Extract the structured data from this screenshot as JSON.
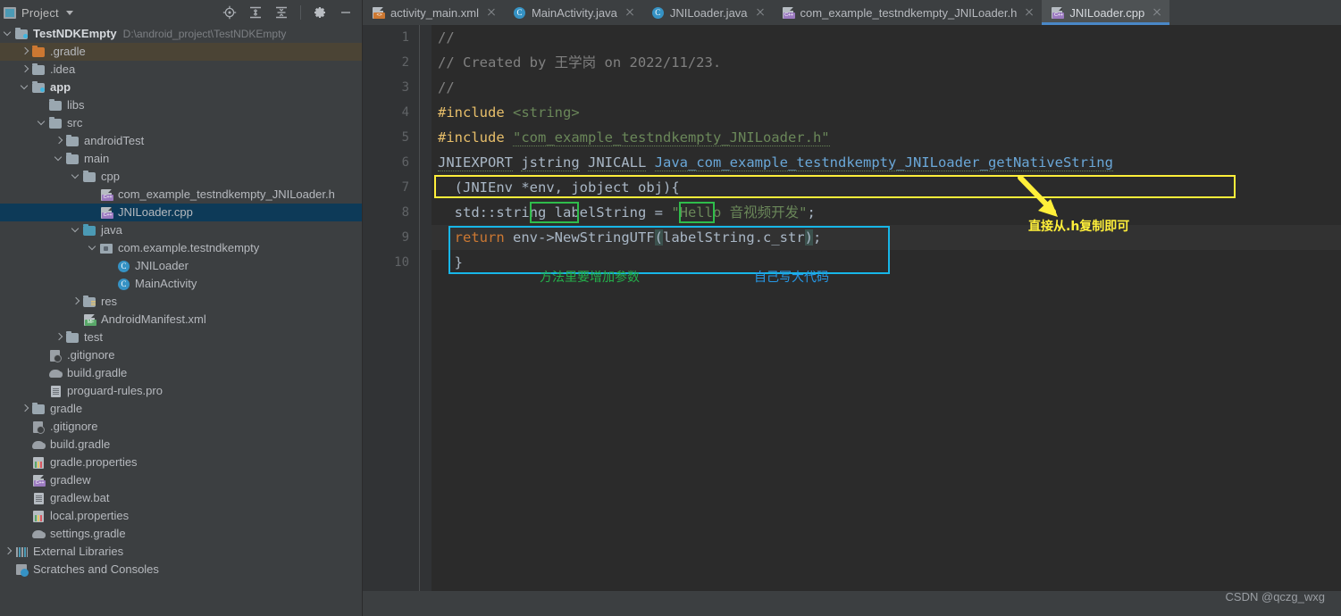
{
  "panel": {
    "title": "Project",
    "icon": "project-icon",
    "dropdown_icon": "chevron-down-icon",
    "tools": [
      {
        "name": "locate-icon",
        "label": "Select Opened File"
      },
      {
        "name": "expand-all-icon",
        "label": "Expand All"
      },
      {
        "name": "collapse-all-icon",
        "label": "Collapse All"
      },
      {
        "name": "settings-gear-icon",
        "label": "Settings"
      },
      {
        "name": "minimize-icon",
        "label": "Hide"
      }
    ]
  },
  "tree": [
    {
      "indent": 0,
      "arrow": "down",
      "icon": "module-folder-icon",
      "label": "TestNDKEmpty",
      "bold": true,
      "sub": "D:\\android_project\\TestNDKEmpty",
      "state": "normal"
    },
    {
      "indent": 1,
      "arrow": "right",
      "icon": "folder-orange-icon",
      "label": ".gradle",
      "state": "hover"
    },
    {
      "indent": 1,
      "arrow": "right",
      "icon": "folder-icon",
      "label": ".idea",
      "state": "normal"
    },
    {
      "indent": 1,
      "arrow": "down",
      "icon": "module-folder-icon",
      "label": "app",
      "bold": true,
      "state": "normal"
    },
    {
      "indent": 2,
      "arrow": "none",
      "icon": "folder-icon",
      "label": "libs",
      "state": "normal"
    },
    {
      "indent": 2,
      "arrow": "down",
      "icon": "folder-icon",
      "label": "src",
      "state": "normal"
    },
    {
      "indent": 3,
      "arrow": "right",
      "icon": "folder-icon",
      "label": "androidTest",
      "state": "normal"
    },
    {
      "indent": 3,
      "arrow": "down",
      "icon": "folder-icon",
      "label": "main",
      "state": "normal"
    },
    {
      "indent": 4,
      "arrow": "down",
      "icon": "folder-icon",
      "label": "cpp",
      "state": "normal"
    },
    {
      "indent": 5,
      "arrow": "none",
      "icon": "cpp-file-icon",
      "label": "com_example_testndkempty_JNILoader.h",
      "state": "normal"
    },
    {
      "indent": 5,
      "arrow": "none",
      "icon": "cpp-file-icon",
      "label": "JNILoader.cpp",
      "state": "selected"
    },
    {
      "indent": 4,
      "arrow": "down",
      "icon": "folder-blue-icon",
      "label": "java",
      "state": "normal"
    },
    {
      "indent": 5,
      "arrow": "down",
      "icon": "package-icon",
      "label": "com.example.testndkempty",
      "state": "normal"
    },
    {
      "indent": 6,
      "arrow": "none",
      "icon": "java-class-icon",
      "label": "JNILoader",
      "state": "normal"
    },
    {
      "indent": 6,
      "arrow": "none",
      "icon": "java-class-icon",
      "label": "MainActivity",
      "state": "normal"
    },
    {
      "indent": 4,
      "arrow": "right",
      "icon": "res-folder-icon",
      "label": "res",
      "state": "normal"
    },
    {
      "indent": 4,
      "arrow": "none",
      "icon": "manifest-file-icon",
      "label": "AndroidManifest.xml",
      "state": "normal"
    },
    {
      "indent": 3,
      "arrow": "right",
      "icon": "folder-icon",
      "label": "test",
      "state": "normal"
    },
    {
      "indent": 2,
      "arrow": "none",
      "icon": "gitignore-icon",
      "label": ".gitignore",
      "state": "normal"
    },
    {
      "indent": 2,
      "arrow": "none",
      "icon": "gradle-file-icon",
      "label": "build.gradle",
      "state": "normal"
    },
    {
      "indent": 2,
      "arrow": "none",
      "icon": "text-file-icon",
      "label": "proguard-rules.pro",
      "state": "normal"
    },
    {
      "indent": 1,
      "arrow": "right",
      "icon": "folder-icon",
      "label": "gradle",
      "state": "normal"
    },
    {
      "indent": 1,
      "arrow": "none",
      "icon": "gitignore-icon",
      "label": ".gitignore",
      "state": "normal"
    },
    {
      "indent": 1,
      "arrow": "none",
      "icon": "gradle-file-icon",
      "label": "build.gradle",
      "state": "normal"
    },
    {
      "indent": 1,
      "arrow": "none",
      "icon": "properties-file-icon",
      "label": "gradle.properties",
      "state": "normal"
    },
    {
      "indent": 1,
      "arrow": "none",
      "icon": "cpp-file-icon",
      "label": "gradlew",
      "state": "normal"
    },
    {
      "indent": 1,
      "arrow": "none",
      "icon": "text-file-icon",
      "label": "gradlew.bat",
      "state": "normal"
    },
    {
      "indent": 1,
      "arrow": "none",
      "icon": "properties-file-icon",
      "label": "local.properties",
      "state": "normal"
    },
    {
      "indent": 1,
      "arrow": "none",
      "icon": "gradle-file-icon",
      "label": "settings.gradle",
      "state": "normal"
    },
    {
      "indent": 0,
      "arrow": "right",
      "icon": "external-libraries-icon",
      "label": "External Libraries",
      "state": "normal"
    },
    {
      "indent": 0,
      "arrow": "none",
      "icon": "scratches-icon",
      "label": "Scratches and Consoles",
      "state": "normal"
    }
  ],
  "tabs": [
    {
      "label": "activity_main.xml",
      "icon": "xml-file-icon",
      "active": false,
      "closable": true
    },
    {
      "label": "MainActivity.java",
      "icon": "java-class-icon",
      "active": false,
      "closable": true
    },
    {
      "label": "JNILoader.java",
      "icon": "java-class-icon",
      "active": false,
      "closable": true
    },
    {
      "label": "com_example_testndkempty_JNILoader.h",
      "icon": "cpp-file-icon",
      "active": false,
      "closable": true
    },
    {
      "label": "JNILoader.cpp",
      "icon": "cpp-file-icon",
      "active": true,
      "closable": true
    }
  ],
  "editor": {
    "line_numbers": [
      "1",
      "2",
      "3",
      "4",
      "5",
      "6",
      "7",
      "8",
      "9",
      "10"
    ],
    "current_line": 9,
    "lines": [
      {
        "n": 1,
        "text": "//"
      },
      {
        "n": 2,
        "text": "// Created by 王学岗 on 2022/11/23."
      },
      {
        "n": 3,
        "text": "//"
      },
      {
        "n": 4,
        "text": "#include <string>"
      },
      {
        "n": 5,
        "text": "#include \"com_example_testndkempty_JNILoader.h\""
      },
      {
        "n": 6,
        "text": "JNIEXPORT jstring JNICALL Java_com_example_testndkempty_JNILoader_getNativeString"
      },
      {
        "n": 7,
        "text": "  (JNIEnv *env, jobject obj){"
      },
      {
        "n": 8,
        "text": "  std::string labelString = \"Hello 音视频开发\";"
      },
      {
        "n": 9,
        "text": "  return env->NewStringUTF(labelString.c_str);"
      },
      {
        "n": 10,
        "text": "  }"
      }
    ],
    "tokens": {
      "c1": "//",
      "c2_a": "// Created by ",
      "c2_b": "王学岗",
      "c2_c": " on 2022/11/23.",
      "c3": "//",
      "c4_kw": "#include",
      "c4_val": "<string>",
      "c5_kw": "#include",
      "c5_val": "\"com_example_testndkempty_JNILoader.h\"",
      "c6_a": "JNIEXPORT",
      "c6_b": "jstring",
      "c6_c": "JNICALL",
      "c6_d": "Java_com_example_testndkempty_JNILoader_getNativeString",
      "c7_a": "(JNIEnv ",
      "c7_b": "*env",
      "c7_c": ", jobject ",
      "c7_d": "obj",
      "c7_e": "){",
      "c8_a": "std::string labelString = ",
      "c8_b": "\"Hello ",
      "c8_c": "音视频开发",
      "c8_d": "\"",
      "c8_e": ";",
      "c9_a": "return",
      "c9_b": " env->NewStringUTF",
      "c9_c": "(",
      "c9_d": "labelString.c_str",
      "c9_e": ")",
      "c9_f": ";",
      "c10": "}"
    }
  },
  "annotations": [
    {
      "name": "annotation-copy-from-h",
      "text": "直接从.h复制即可",
      "color": "#ffef3a",
      "kind": "yellow"
    },
    {
      "name": "annotation-add-params",
      "text": "方法里要增加参数",
      "color": "#24b14b",
      "kind": "green"
    },
    {
      "name": "annotation-write-code",
      "text": "自己写大代码",
      "color": "#2699e8",
      "kind": "blue"
    }
  ],
  "highlight_boxes": [
    {
      "name": "yellow-box-signature",
      "color": "#ffef3a"
    },
    {
      "name": "green-box-env-param",
      "color": "#2fbd4b"
    },
    {
      "name": "green-box-obj-param",
      "color": "#2fbd4b"
    },
    {
      "name": "cyan-box-body",
      "color": "#17b6e8"
    }
  ],
  "watermark": "CSDN @qczg_wxg",
  "colors": {
    "panel_bg": "#3c3f41",
    "editor_bg": "#2b2b2b",
    "gutter_bg": "#313335",
    "selection_blue": "#0d3a58",
    "hover_brown": "#4b4435",
    "tab_active_underline": "#4a88c7"
  }
}
